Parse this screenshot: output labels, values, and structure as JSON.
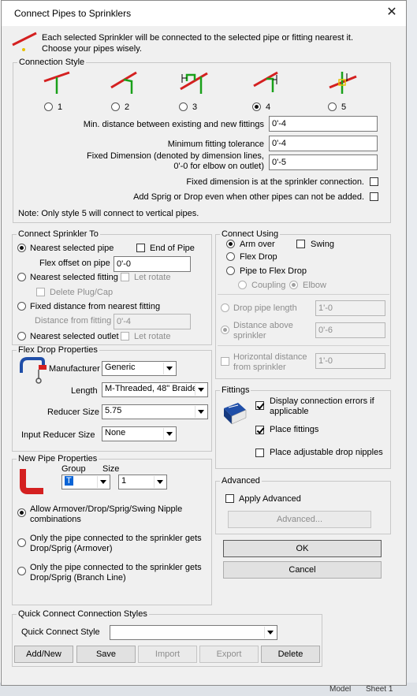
{
  "window": {
    "title": "Connect Pipes to Sprinklers"
  },
  "intro": {
    "line1": "Each selected Sprinkler will be connected to the selected pipe or fitting nearest it.",
    "line2": "Choose your pipes wisely."
  },
  "connection_style": {
    "legend": "Connection Style",
    "options": [
      "1",
      "2",
      "3",
      "4",
      "5"
    ],
    "selected": "4",
    "min_distance_label": "Min. distance between existing and new fittings",
    "min_distance_value": "0'-4",
    "min_fitting_tol_label": "Minimum fitting tolerance",
    "min_fitting_tol_value": "0'-4",
    "fixed_dim_label_1": "Fixed Dimension (denoted by dimension lines,",
    "fixed_dim_label_2": "0'-0 for elbow on outlet)",
    "fixed_dim_value": "0'-5",
    "fixed_at_conn_label": "Fixed dimension is at the sprinkler connection.",
    "add_sprig_label": "Add Sprig or Drop even when other pipes can not be added.",
    "note": "Note: Only style 5 will connect to vertical pipes."
  },
  "connect_sprinkler_to": {
    "legend": "Connect Sprinkler To",
    "nearest_pipe": "Nearest selected pipe",
    "end_of_pipe": "End of Pipe",
    "flex_offset_label": "Flex offset on pipe",
    "flex_offset_value": "0'-0",
    "nearest_fitting": "Nearest selected fitting",
    "let_rotate": "Let rotate",
    "delete_plug": "Delete Plug/Cap",
    "fixed_distance": "Fixed distance from nearest fitting",
    "distance_from_fitting_label": "Distance from fitting",
    "distance_from_fitting_value": "0'-4",
    "nearest_outlet": "Nearest selected outlet",
    "let_rotate_2": "Let rotate"
  },
  "connect_using": {
    "legend": "Connect Using",
    "arm_over": "Arm over",
    "swing": "Swing",
    "flex_drop": "Flex Drop",
    "pipe_to_flex": "Pipe to Flex Drop",
    "coupling": "Coupling",
    "elbow": "Elbow",
    "drop_pipe_length_label": "Drop pipe length",
    "drop_pipe_length_value": "1'-0",
    "distance_above_label_1": "Distance above",
    "distance_above_label_2": "sprinkler",
    "distance_above_value": "0'-6",
    "horiz_distance_label_1": "Horizontal distance",
    "horiz_distance_label_2": "from sprinkler",
    "horiz_distance_value": "1'-0"
  },
  "flex_drop": {
    "legend": "Flex Drop Properties",
    "manufacturer_label": "Manufacturer",
    "manufacturer_value": "Generic",
    "length_label": "Length",
    "length_value": "M-Threaded, 48\" Braide",
    "reducer_label": "Reducer Size",
    "reducer_value": "5.75",
    "input_reducer_label": "Input Reducer Size",
    "input_reducer_value": "None"
  },
  "fittings": {
    "legend": "Fittings",
    "display_errors_1": "Display connection errors if",
    "display_errors_2": "applicable",
    "place_fittings": "Place fittings",
    "place_nipples": "Place adjustable drop nipples"
  },
  "new_pipe": {
    "legend": "New Pipe Properties",
    "group_label": "Group",
    "group_value": "T",
    "size_label": "Size",
    "size_value": "1",
    "opt1_1": "Allow Armover/Drop/Sprig/Swing Nipple",
    "opt1_2": "combinations",
    "opt2_1": "Only the pipe connected to the sprinkler gets",
    "opt2_2": "Drop/Sprig (Armover)",
    "opt3_1": "Only the pipe connected to the sprinkler gets",
    "opt3_2": "Drop/Sprig (Branch Line)"
  },
  "advanced": {
    "legend": "Advanced",
    "apply_label": "Apply Advanced",
    "button": "Advanced..."
  },
  "buttons": {
    "ok": "OK",
    "cancel": "Cancel"
  },
  "quick_connect": {
    "legend": "Quick Connect Connection Styles",
    "style_label": "Quick Connect Style",
    "style_value": "",
    "add_new": "Add/New",
    "save": "Save",
    "import": "Import",
    "export": "Export",
    "delete": "Delete"
  },
  "background": {
    "model_tab": "Model",
    "sheet_tab": "Sheet 1"
  },
  "colors": {
    "pipe_red": "#d42020",
    "pipe_green": "#1aa01a",
    "book_blue": "#1f4ea8",
    "selection": "#0a64d6"
  }
}
